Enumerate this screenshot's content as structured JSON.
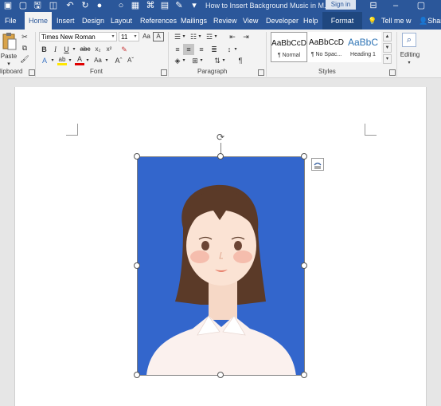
{
  "window": {
    "doc_title": "How to Insert Background Music in M...",
    "sign_in": "Sign in"
  },
  "tabs": [
    "File",
    "Home",
    "Insert",
    "Design",
    "Layout",
    "References",
    "Mailings",
    "Review",
    "View",
    "Developer",
    "Help",
    "Format"
  ],
  "active_tab": "Home",
  "tell_me": "Tell me w",
  "share": "Shar",
  "clipboard": {
    "label": "lipboard",
    "paste": "Paste"
  },
  "font": {
    "label": "Font",
    "name": "Times New Roman",
    "size": "11"
  },
  "paragraph": {
    "label": "Paragraph"
  },
  "styles": {
    "label": "Styles",
    "items": [
      {
        "preview": "AaBbCcD",
        "name": "¶ Normal"
      },
      {
        "preview": "AaBbCcD",
        "name": "¶ No Spac..."
      },
      {
        "preview": "AaBbC",
        "name": "Heading 1"
      }
    ]
  },
  "editing": {
    "label": "Editing"
  },
  "colors": {
    "title_bar": "#2b579a",
    "ribbon": "#f3f3f3",
    "picture_background": "#3366cc",
    "highlight": "#ffe600",
    "font_color": "#e00000"
  }
}
